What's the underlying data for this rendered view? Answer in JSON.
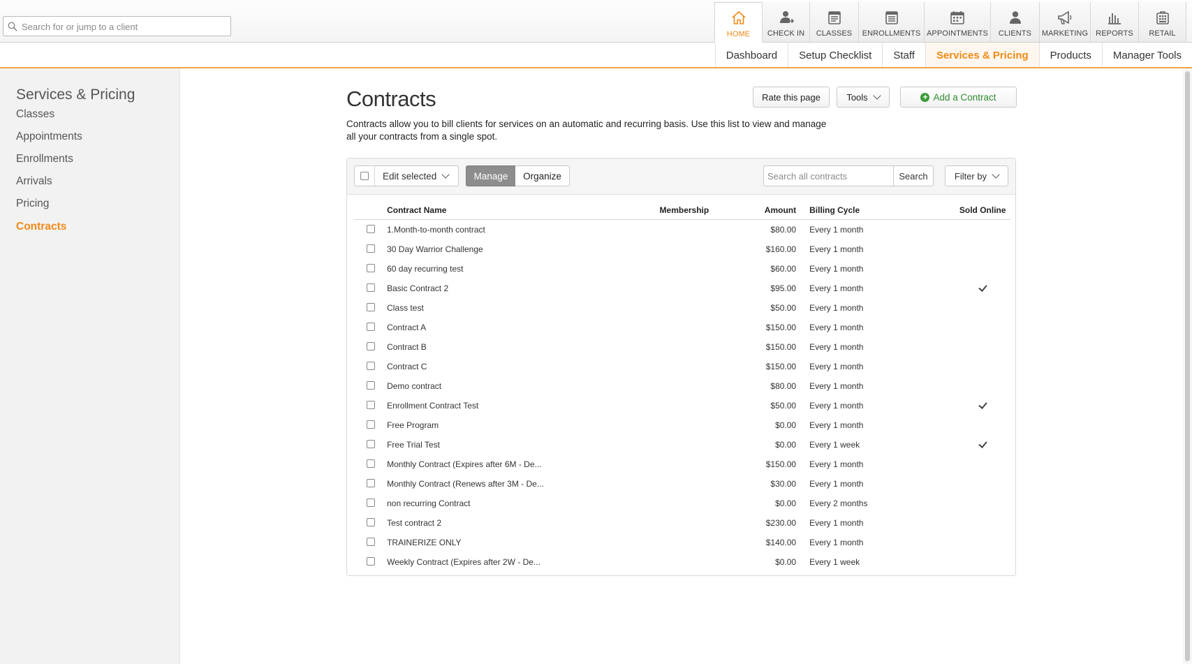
{
  "search": {
    "placeholder": "Search for or jump to a client"
  },
  "nav": [
    {
      "label": "HOME",
      "icon": "home-icon",
      "active": true,
      "w": 68
    },
    {
      "label": "CHECK IN",
      "icon": "check-in-icon",
      "w": 68
    },
    {
      "label": "CLASSES",
      "icon": "classes-icon",
      "w": 70
    },
    {
      "label": "ENROLLMENTS",
      "icon": "enrollments-icon",
      "w": 94
    },
    {
      "label": "APPOINTMENTS",
      "icon": "appointments-icon",
      "w": 95
    },
    {
      "label": "CLIENTS",
      "icon": "clients-icon",
      "w": 70
    },
    {
      "label": "MARKETING",
      "icon": "marketing-icon",
      "w": 73
    },
    {
      "label": "REPORTS",
      "icon": "reports-icon",
      "w": 69
    },
    {
      "label": "RETAIL",
      "icon": "retail-icon",
      "w": 69
    }
  ],
  "subnav": [
    {
      "label": "Dashboard"
    },
    {
      "label": "Setup Checklist"
    },
    {
      "label": "Staff"
    },
    {
      "label": "Services & Pricing",
      "active": true
    },
    {
      "label": "Products"
    },
    {
      "label": "Manager Tools"
    }
  ],
  "sidebar": {
    "title": "Services & Pricing",
    "items": [
      {
        "label": "Classes"
      },
      {
        "label": "Appointments"
      },
      {
        "label": "Enrollments"
      },
      {
        "label": "Arrivals"
      },
      {
        "label": "Pricing"
      },
      {
        "label": "Contracts",
        "active": true
      }
    ]
  },
  "page": {
    "title": "Contracts",
    "description": "Contracts allow you to bill clients for services on an automatic and recurring basis. Use this list to view and manage all your contracts from a single spot.",
    "rate_label": "Rate this page",
    "tools_label": "Tools",
    "add_label": "Add a Contract"
  },
  "toolbar": {
    "edit_selected": "Edit selected",
    "manage": "Manage",
    "organize": "Organize",
    "search_placeholder": "Search all contracts",
    "search_button": "Search",
    "filter_by": "Filter by"
  },
  "table": {
    "headers": {
      "name": "Contract Name",
      "membership": "Membership",
      "amount": "Amount",
      "cycle": "Billing Cycle",
      "sold": "Sold Online"
    },
    "rows": [
      {
        "name": "1.Month-to-month contract",
        "membership": "",
        "amount": "$80.00",
        "cycle": "Every 1 month",
        "sold": false
      },
      {
        "name": "30 Day Warrior Challenge",
        "membership": "",
        "amount": "$160.00",
        "cycle": "Every 1 month",
        "sold": false
      },
      {
        "name": "60 day recurring test",
        "membership": "",
        "amount": "$60.00",
        "cycle": "Every 1 month",
        "sold": false
      },
      {
        "name": "Basic Contract 2",
        "membership": "",
        "amount": "$95.00",
        "cycle": "Every 1 month",
        "sold": true
      },
      {
        "name": "Class test",
        "membership": "",
        "amount": "$50.00",
        "cycle": "Every 1 month",
        "sold": false
      },
      {
        "name": "Contract A",
        "membership": "",
        "amount": "$150.00",
        "cycle": "Every 1 month",
        "sold": false
      },
      {
        "name": "Contract B",
        "membership": "",
        "amount": "$150.00",
        "cycle": "Every 1 month",
        "sold": false
      },
      {
        "name": "Contract C",
        "membership": "",
        "amount": "$150.00",
        "cycle": "Every 1 month",
        "sold": false
      },
      {
        "name": "Demo contract",
        "membership": "",
        "amount": "$80.00",
        "cycle": "Every 1 month",
        "sold": false
      },
      {
        "name": "Enrollment Contract Test",
        "membership": "",
        "amount": "$50.00",
        "cycle": "Every 1 month",
        "sold": true
      },
      {
        "name": "Free Program",
        "membership": "",
        "amount": "$0.00",
        "cycle": "Every 1 month",
        "sold": false
      },
      {
        "name": "Free Trial Test",
        "membership": "",
        "amount": "$0.00",
        "cycle": "Every 1 week",
        "sold": true
      },
      {
        "name": "Monthly Contract (Expires after 6M - De...",
        "membership": "",
        "amount": "$150.00",
        "cycle": "Every 1 month",
        "sold": false
      },
      {
        "name": "Monthly Contract (Renews after 3M - De...",
        "membership": "",
        "amount": "$30.00",
        "cycle": "Every 1 month",
        "sold": false
      },
      {
        "name": "non recurring Contract",
        "membership": "",
        "amount": "$0.00",
        "cycle": "Every 2 months",
        "sold": false
      },
      {
        "name": "Test contract 2",
        "membership": "",
        "amount": "$230.00",
        "cycle": "Every 1 month",
        "sold": false
      },
      {
        "name": "TRAINERIZE ONLY",
        "membership": "",
        "amount": "$140.00",
        "cycle": "Every 1 month",
        "sold": false
      },
      {
        "name": "Weekly Contract (Expires after 2W - De...",
        "membership": "",
        "amount": "$0.00",
        "cycle": "Every 1 week",
        "sold": false
      }
    ]
  },
  "colors": {
    "accent": "#f08a16",
    "add_green": "#2e8b2e",
    "manage_bg": "#8d8d8d"
  }
}
